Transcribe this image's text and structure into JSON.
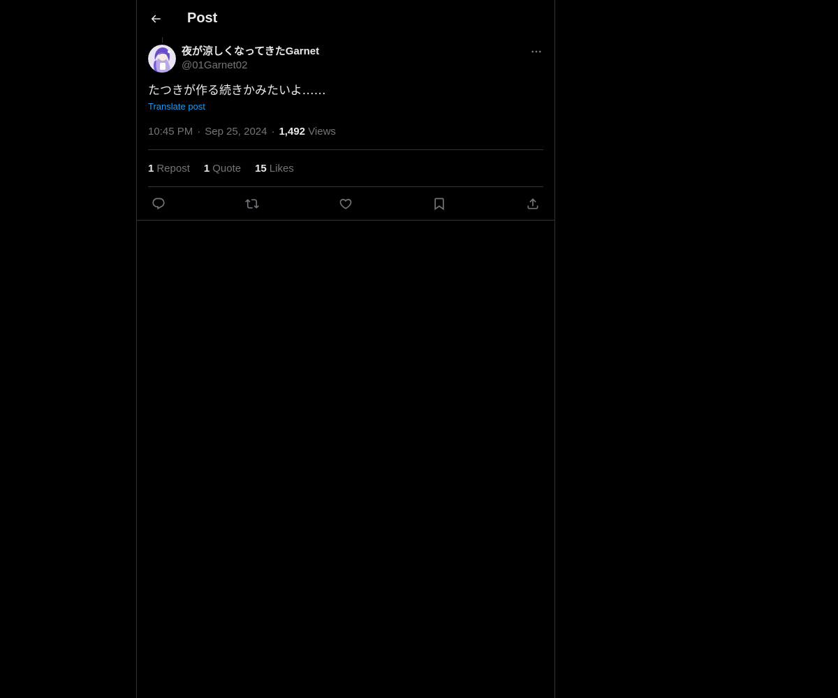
{
  "header": {
    "title": "Post",
    "back_icon": "arrow-left-icon"
  },
  "post": {
    "author": {
      "display_name": "夜が涼しくなってきたGarnet",
      "handle": "@01Garnet02",
      "avatar_icon": "avatar-image"
    },
    "more_icon": "more-horizontal-icon",
    "text": "たつきが作る続きかみたいよ……",
    "translate_label": "Translate post",
    "time": "10:45 PM",
    "date": "Sep 25, 2024",
    "views_count": "1,492",
    "views_label": "Views",
    "stats": [
      {
        "count": "1",
        "label": "Repost"
      },
      {
        "count": "1",
        "label": "Quote"
      },
      {
        "count": "15",
        "label": "Likes"
      }
    ],
    "actions": [
      "reply-icon",
      "repost-icon",
      "like-icon",
      "bookmark-icon",
      "share-icon"
    ]
  },
  "colors": {
    "background": "#000000",
    "text_primary": "#e7e9ea",
    "text_secondary": "#71767b",
    "link": "#1d9bf0",
    "border": "#2f3336"
  }
}
